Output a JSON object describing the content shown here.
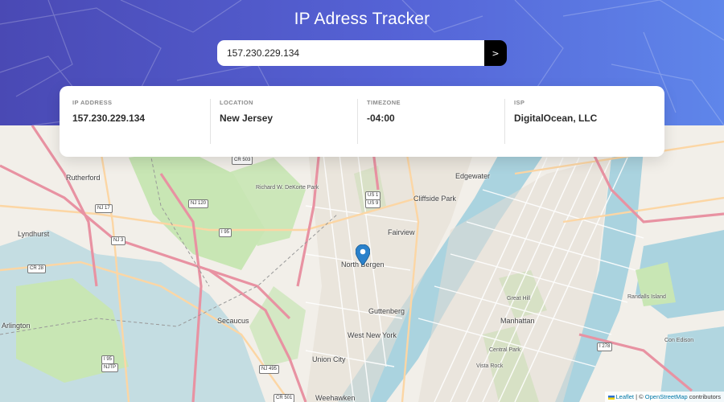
{
  "header": {
    "title": "IP Adress Tracker"
  },
  "search": {
    "value": "157.230.229.134",
    "button_label": ">"
  },
  "info": [
    {
      "label": "IP ADDRESS",
      "value": "157.230.229.134"
    },
    {
      "label": "LOCATION",
      "value": "New Jersey"
    },
    {
      "label": "TIMEZONE",
      "value": "-04:00"
    },
    {
      "label": "ISP",
      "value": "DigitalOcean, LLC"
    }
  ],
  "map": {
    "places": {
      "rutherford": "Rutherford",
      "lyndhurst": "Lyndhurst",
      "arlington": "Arlington",
      "secaucus": "Secaucus",
      "north_bergen": "North Bergen",
      "fairview": "Fairview",
      "cliffside_park": "Cliffside Park",
      "edgewater": "Edgewater",
      "guttenberg": "Guttenberg",
      "west_new_york": "West New York",
      "union_city": "Union City",
      "weehawken": "Weehawken",
      "manhattan": "Manhattan",
      "central_park": "Central Park",
      "great_hill": "Great Hill",
      "vista_rock": "Vista Rock",
      "con_edison": "Con Edison",
      "richard_w_dekorte_park": "Richard W. DeKorte Park",
      "randalls_island": "Randalls Island"
    },
    "shields": {
      "nj17": "NJ 17",
      "nj3": "NJ 3",
      "nj120": "NJ 120",
      "i95": "I 95",
      "cr503": "CR 503",
      "cr28": "CR 28",
      "us1": "US 1",
      "us9": "US 9",
      "nj495": "NJ 495",
      "cr501": "CR 501",
      "i278": "I 278",
      "i95b": "I 95",
      "njtp": "NJTP"
    },
    "colors": {
      "water": "#aad3df",
      "park": "#c8e6b4",
      "land": "#f2efe9",
      "motorway": "#e892a2",
      "primary": "#fcd6a4",
      "marker": "#2a81cb"
    }
  },
  "attribution": {
    "leaflet": "Leaflet",
    "separator": " | © ",
    "osm": "OpenStreetMap",
    "suffix": " contributors"
  }
}
